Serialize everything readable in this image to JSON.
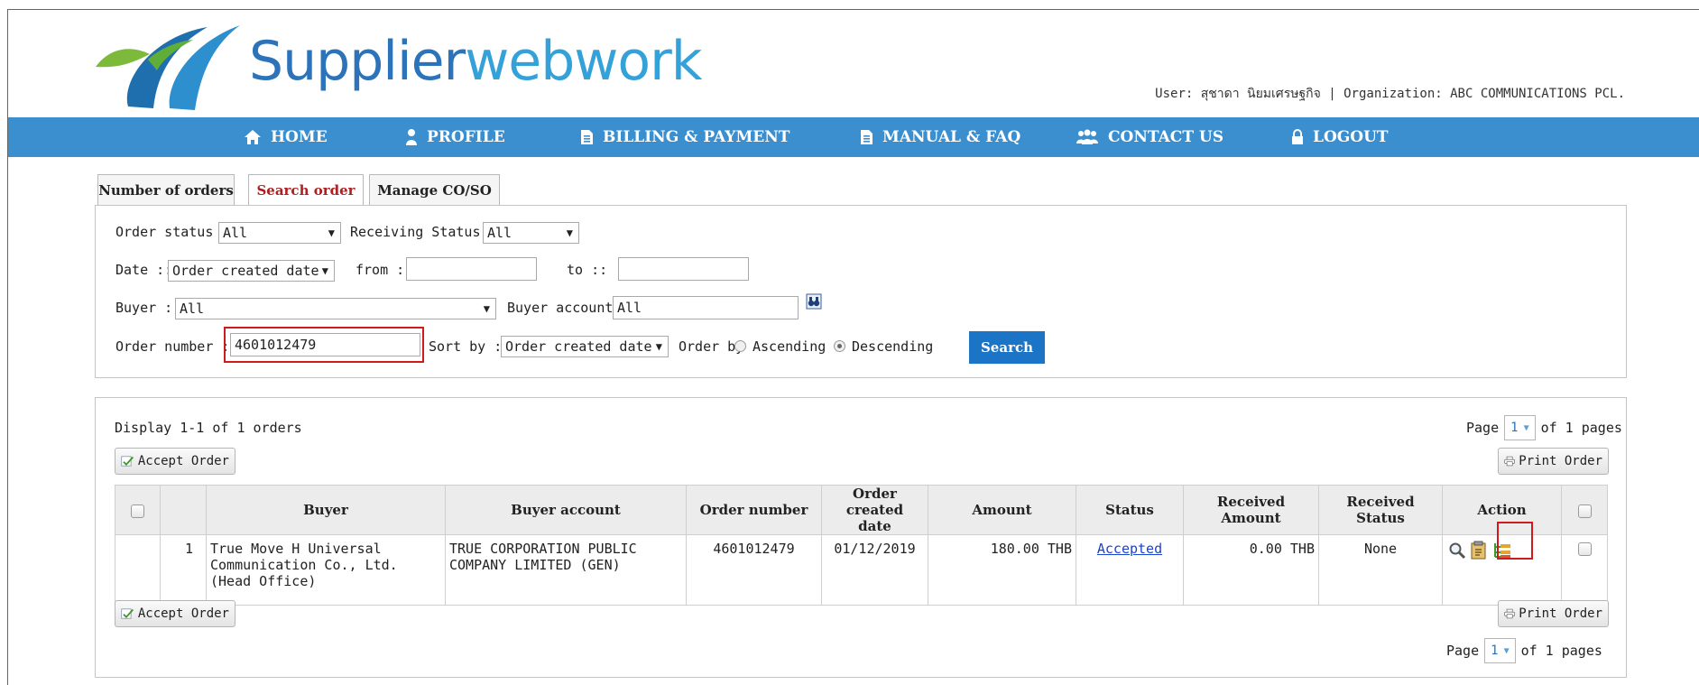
{
  "header": {
    "logo_word_1": "Supplier",
    "logo_word_2": "webwork",
    "user_line": "User: สุชาดา นิยมเศรษฐกิจ | Organization: ABC COMMUNICATIONS PCL."
  },
  "nav": {
    "home": "HOME",
    "profile": "PROFILE",
    "billing": "BILLING & PAYMENT",
    "manual": "MANUAL & FAQ",
    "contact": "CONTACT US",
    "logout": "LOGOUT"
  },
  "tabs": {
    "number_of_orders": "Number of orders",
    "search_order": "Search order",
    "manage": "Manage CO/SO"
  },
  "search": {
    "order_status_label": "Order status ::",
    "order_status_value": "All",
    "receiving_status_label": "Receiving Status ::",
    "receiving_status_value": "All",
    "date_label": "Date ::",
    "date_type_value": "Order created date",
    "from_label": "from ::",
    "to_label": "to ::",
    "buyer_label": "Buyer ::",
    "buyer_value": "All",
    "buyer_account_label": "Buyer account ::",
    "buyer_account_value": "All",
    "order_number_label": "Order number ::",
    "order_number_value": "4601012479",
    "sort_by_label": "Sort by ::",
    "sort_by_value": "Order created date",
    "order_by_label": "Order by",
    "ascending": "Ascending",
    "descending": "Descending",
    "search_button": "Search"
  },
  "results": {
    "display_text": "Display 1-1 of 1 orders",
    "accept_button": "Accept Order",
    "print_button": "Print Order",
    "page_label": "Page",
    "page_value": "1",
    "of_pages": "of 1 pages",
    "columns": {
      "buyer": "Buyer",
      "buyer_account": "Buyer account",
      "order_number": "Order number",
      "order_created_date_1": "Order created",
      "order_created_date_2": "date",
      "amount": "Amount",
      "status": "Status",
      "received_amount": "Received Amount",
      "received_status": "Received Status",
      "action": "Action"
    },
    "rows": [
      {
        "index": "1",
        "buyer": "True Move H Universal Communication Co., Ltd. (Head Office)",
        "buyer_account": "TRUE CORPORATION PUBLIC COMPANY LIMITED (GEN)",
        "order_number": "4601012479",
        "order_created_date": "01/12/2019",
        "amount": "180.00 THB",
        "status": "Accepted",
        "received_amount": "0.00 THB",
        "received_status": "None"
      }
    ]
  },
  "colors": {
    "nav_blue": "#3b8fcf",
    "search_button": "#1c74c7",
    "highlight_red": "#d11a1a",
    "active_tab_text": "#b01f1f",
    "logo_dark_blue": "#2d73b9"
  },
  "icons": [
    "home-icon",
    "profile-icon",
    "document-icon",
    "users-icon",
    "lock-icon",
    "binoculars-icon",
    "accept-icon",
    "printer-icon",
    "magnifier-icon",
    "notepad-icon",
    "tree-icon"
  ]
}
